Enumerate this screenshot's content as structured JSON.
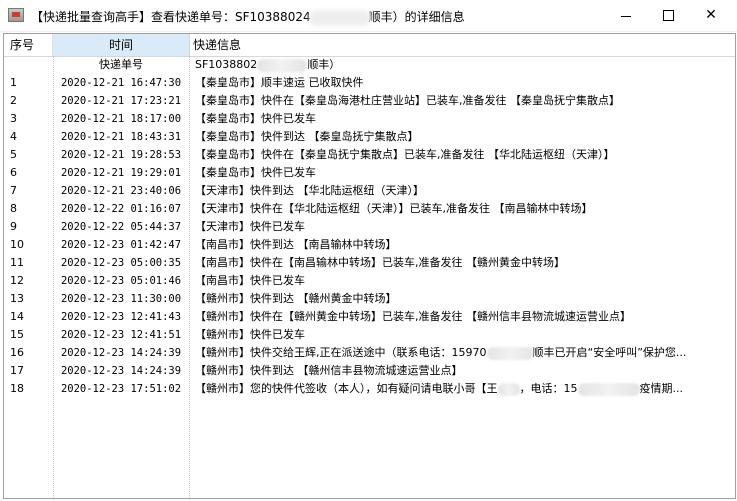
{
  "window": {
    "title_prefix": "【快递批量查询高手】查看快递单号：SF10388024",
    "title_suffix": "顺丰）的详细信息",
    "app_icon": "app-icon",
    "minimize_icon": "minimize-icon",
    "maximize_icon": "maximize-icon",
    "close_icon": "close-icon",
    "close_glyph": "✕"
  },
  "table": {
    "headers": {
      "seq": "序号",
      "time": "时间",
      "info": "快递信息"
    },
    "subheader": {
      "time": "快递单号",
      "info_prefix": "SF1038802",
      "info_suffix": "顺丰）"
    },
    "rows": [
      {
        "seq": "1",
        "time": "2020-12-21 16:47:30",
        "info": "【秦皇岛市】顺丰速运 已收取快件"
      },
      {
        "seq": "2",
        "time": "2020-12-21 17:23:21",
        "info": "【秦皇岛市】快件在【秦皇岛海港杜庄营业站】已装车,准备发往 【秦皇岛抚宁集散点】"
      },
      {
        "seq": "3",
        "time": "2020-12-21 18:17:00",
        "info": "【秦皇岛市】快件已发车"
      },
      {
        "seq": "4",
        "time": "2020-12-21 18:43:31",
        "info": "【秦皇岛市】快件到达 【秦皇岛抚宁集散点】"
      },
      {
        "seq": "5",
        "time": "2020-12-21 19:28:53",
        "info": "【秦皇岛市】快件在【秦皇岛抚宁集散点】已装车,准备发往 【华北陆运枢纽（天津）】"
      },
      {
        "seq": "6",
        "time": "2020-12-21 19:29:01",
        "info": "【秦皇岛市】快件已发车"
      },
      {
        "seq": "7",
        "time": "2020-12-21 23:40:06",
        "info": "【天津市】快件到达 【华北陆运枢纽（天津）】"
      },
      {
        "seq": "8",
        "time": "2020-12-22 01:16:07",
        "info": "【天津市】快件在【华北陆运枢纽（天津）】已装车,准备发往 【南昌输林中转场】"
      },
      {
        "seq": "9",
        "time": "2020-12-22 05:44:37",
        "info": "【天津市】快件已发车"
      },
      {
        "seq": "10",
        "time": "2020-12-23 01:42:47",
        "info": "【南昌市】快件到达 【南昌输林中转场】"
      },
      {
        "seq": "11",
        "time": "2020-12-23 05:00:35",
        "info": "【南昌市】快件在【南昌输林中转场】已装车,准备发往 【赣州黄金中转场】"
      },
      {
        "seq": "12",
        "time": "2020-12-23 05:01:46",
        "info": "【南昌市】快件已发车"
      },
      {
        "seq": "13",
        "time": "2020-12-23 11:30:00",
        "info": "【赣州市】快件到达 【赣州黄金中转场】"
      },
      {
        "seq": "14",
        "time": "2020-12-23 12:41:43",
        "info": "【赣州市】快件在【赣州黄金中转场】已装车,准备发往 【赣州信丰县物流城速运营业点】"
      },
      {
        "seq": "15",
        "time": "2020-12-23 12:41:51",
        "info": "【赣州市】快件已发车"
      },
      {
        "seq": "16",
        "time": "2020-12-23 14:24:39",
        "info": "【赣州市】快件交给王辉,正在派送途中（联系电话：15970",
        "info_tail": "顺丰已开启“安全呼叫”保护您..."
      },
      {
        "seq": "17",
        "time": "2020-12-23 14:24:39",
        "info": "【赣州市】快件到达 【赣州信丰县物流城速运营业点】"
      },
      {
        "seq": "18",
        "time": "2020-12-23 17:51:02",
        "info": "【赣州市】您的快件代签收（本人），如有疑问请电联小哥【王",
        "info_mid": "，电话：15",
        "info_tail": "疫情期..."
      }
    ]
  }
}
